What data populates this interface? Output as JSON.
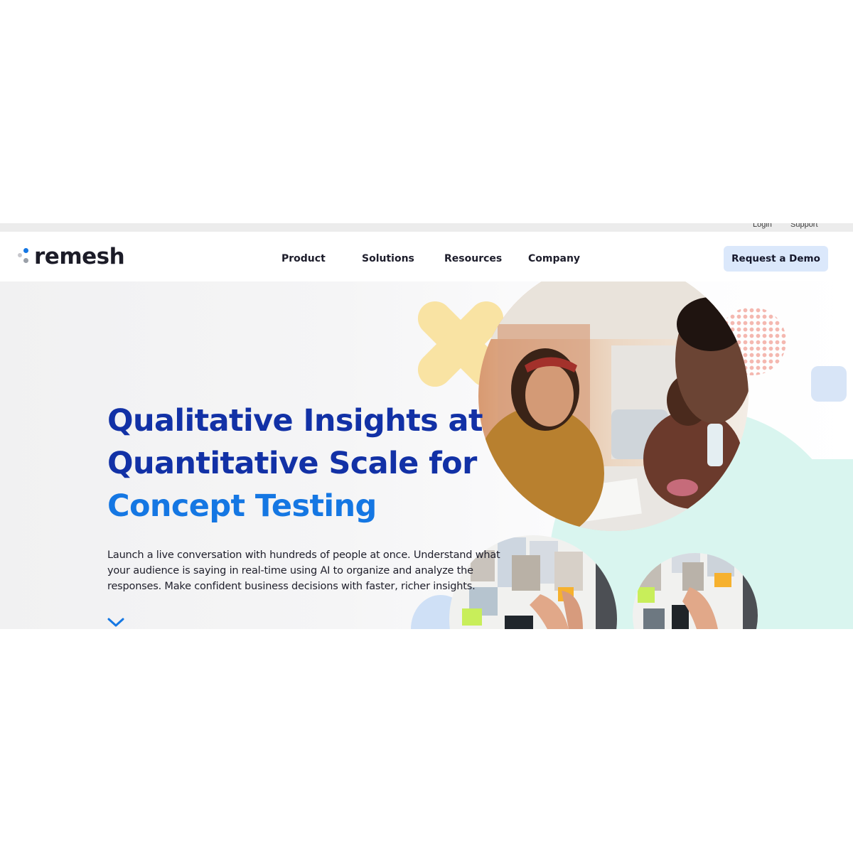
{
  "utility_nav": {
    "login": "Login",
    "support": "Support"
  },
  "brand": {
    "name": "remesh"
  },
  "nav": {
    "items": [
      {
        "label": "Product"
      },
      {
        "label": "Solutions"
      },
      {
        "label": "Resources"
      },
      {
        "label": "Company"
      }
    ],
    "cta": "Request a Demo"
  },
  "hero": {
    "headline": {
      "line1": "Qualitative Insights at",
      "line2": "Quantitative Scale for",
      "line3": "Concept Testing"
    },
    "body": "Launch a live conversation with hundreds of people at once. Understand what your audience is saying in real-time using AI to organize and analyze the responses. Make confident business decisions with faster, richer insights.",
    "scroll_icon": "chevron-down-icon"
  },
  "colors": {
    "headline_primary": "#1231a6",
    "headline_accent": "#1577e3",
    "cta_background": "#dbe8fb",
    "shape_yellow": "#f9e3a3",
    "shape_mint": "#d9f5ef",
    "shape_pink_dots": "#f4b8b0",
    "shape_blue_square": "#d8e5f7"
  }
}
